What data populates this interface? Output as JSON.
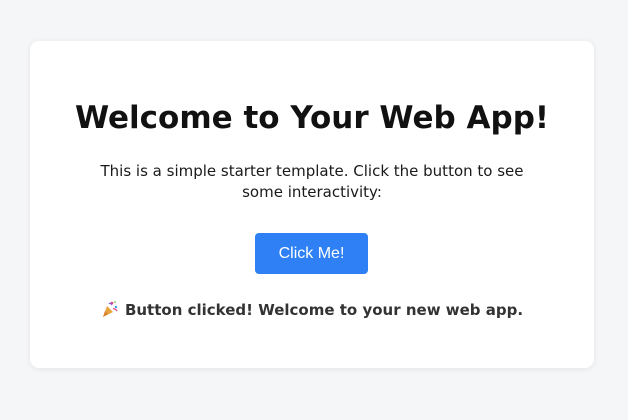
{
  "main": {
    "title": "Welcome to Your Web App!",
    "description": "This is a simple starter template. Click the button to see some interactivity:",
    "button_label": "Click Me!",
    "message_text": "Button clicked! Welcome to your new web app.",
    "message_icon": "party-popper-icon"
  },
  "colors": {
    "page_background": "#f5f6f8",
    "card_background": "#ffffff",
    "button": "#2f80f5"
  }
}
